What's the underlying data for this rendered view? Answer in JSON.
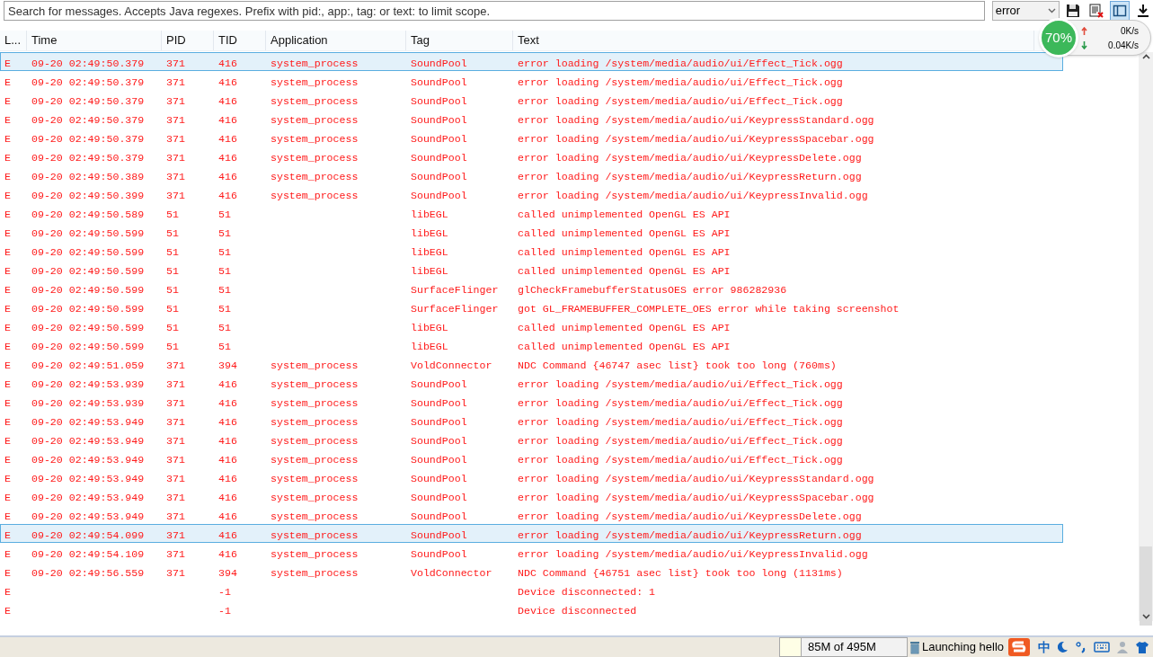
{
  "toolbar": {
    "search": {
      "placeholder": "Search for messages. Accepts Java regexes. Prefix with pid:, app:, tag: or text: to limit scope."
    },
    "level_filter": "error",
    "buttons": [
      {
        "kind": "save",
        "selected": false
      },
      {
        "kind": "clear",
        "selected": false
      },
      {
        "kind": "toggle",
        "selected": true
      },
      {
        "kind": "scroll",
        "selected": false
      }
    ]
  },
  "net_monitor": {
    "percent": "70%",
    "upload": "0K/s",
    "download": "0.04K/s"
  },
  "table": {
    "columns": [
      "L...",
      "Time",
      "PID",
      "TID",
      "Application",
      "Tag",
      "Text"
    ],
    "rows": [
      {
        "selected": true,
        "cells": [
          "E",
          "09-20 02:49:50.379",
          "371",
          "416",
          "system_process",
          "SoundPool",
          "error loading /system/media/audio/ui/Effect_Tick.ogg"
        ]
      },
      {
        "selected": false,
        "cells": [
          "E",
          "09-20 02:49:50.379",
          "371",
          "416",
          "system_process",
          "SoundPool",
          "error loading /system/media/audio/ui/Effect_Tick.ogg"
        ]
      },
      {
        "selected": false,
        "cells": [
          "E",
          "09-20 02:49:50.379",
          "371",
          "416",
          "system_process",
          "SoundPool",
          "error loading /system/media/audio/ui/Effect_Tick.ogg"
        ]
      },
      {
        "selected": false,
        "cells": [
          "E",
          "09-20 02:49:50.379",
          "371",
          "416",
          "system_process",
          "SoundPool",
          "error loading /system/media/audio/ui/KeypressStandard.ogg"
        ]
      },
      {
        "selected": false,
        "cells": [
          "E",
          "09-20 02:49:50.379",
          "371",
          "416",
          "system_process",
          "SoundPool",
          "error loading /system/media/audio/ui/KeypressSpacebar.ogg"
        ]
      },
      {
        "selected": false,
        "cells": [
          "E",
          "09-20 02:49:50.379",
          "371",
          "416",
          "system_process",
          "SoundPool",
          "error loading /system/media/audio/ui/KeypressDelete.ogg"
        ]
      },
      {
        "selected": false,
        "cells": [
          "E",
          "09-20 02:49:50.389",
          "371",
          "416",
          "system_process",
          "SoundPool",
          "error loading /system/media/audio/ui/KeypressReturn.ogg"
        ]
      },
      {
        "selected": false,
        "cells": [
          "E",
          "09-20 02:49:50.399",
          "371",
          "416",
          "system_process",
          "SoundPool",
          "error loading /system/media/audio/ui/KeypressInvalid.ogg"
        ]
      },
      {
        "selected": false,
        "cells": [
          "E",
          "09-20 02:49:50.589",
          "51",
          "51",
          "",
          "libEGL",
          "called unimplemented OpenGL ES API"
        ]
      },
      {
        "selected": false,
        "cells": [
          "E",
          "09-20 02:49:50.599",
          "51",
          "51",
          "",
          "libEGL",
          "called unimplemented OpenGL ES API"
        ]
      },
      {
        "selected": false,
        "cells": [
          "E",
          "09-20 02:49:50.599",
          "51",
          "51",
          "",
          "libEGL",
          "called unimplemented OpenGL ES API"
        ]
      },
      {
        "selected": false,
        "cells": [
          "E",
          "09-20 02:49:50.599",
          "51",
          "51",
          "",
          "libEGL",
          "called unimplemented OpenGL ES API"
        ]
      },
      {
        "selected": false,
        "cells": [
          "E",
          "09-20 02:49:50.599",
          "51",
          "51",
          "",
          "SurfaceFlinger",
          "glCheckFramebufferStatusOES error 986282936"
        ]
      },
      {
        "selected": false,
        "cells": [
          "E",
          "09-20 02:49:50.599",
          "51",
          "51",
          "",
          "SurfaceFlinger",
          "got GL_FRAMEBUFFER_COMPLETE_OES error while taking screenshot"
        ]
      },
      {
        "selected": false,
        "cells": [
          "E",
          "09-20 02:49:50.599",
          "51",
          "51",
          "",
          "libEGL",
          "called unimplemented OpenGL ES API"
        ]
      },
      {
        "selected": false,
        "cells": [
          "E",
          "09-20 02:49:50.599",
          "51",
          "51",
          "",
          "libEGL",
          "called unimplemented OpenGL ES API"
        ]
      },
      {
        "selected": false,
        "cells": [
          "E",
          "09-20 02:49:51.059",
          "371",
          "394",
          "system_process",
          "VoldConnector",
          "NDC Command {46747 asec list} took too long (760ms)"
        ]
      },
      {
        "selected": false,
        "cells": [
          "E",
          "09-20 02:49:53.939",
          "371",
          "416",
          "system_process",
          "SoundPool",
          "error loading /system/media/audio/ui/Effect_Tick.ogg"
        ]
      },
      {
        "selected": false,
        "cells": [
          "E",
          "09-20 02:49:53.939",
          "371",
          "416",
          "system_process",
          "SoundPool",
          "error loading /system/media/audio/ui/Effect_Tick.ogg"
        ]
      },
      {
        "selected": false,
        "cells": [
          "E",
          "09-20 02:49:53.949",
          "371",
          "416",
          "system_process",
          "SoundPool",
          "error loading /system/media/audio/ui/Effect_Tick.ogg"
        ]
      },
      {
        "selected": false,
        "cells": [
          "E",
          "09-20 02:49:53.949",
          "371",
          "416",
          "system_process",
          "SoundPool",
          "error loading /system/media/audio/ui/Effect_Tick.ogg"
        ]
      },
      {
        "selected": false,
        "cells": [
          "E",
          "09-20 02:49:53.949",
          "371",
          "416",
          "system_process",
          "SoundPool",
          "error loading /system/media/audio/ui/Effect_Tick.ogg"
        ]
      },
      {
        "selected": false,
        "cells": [
          "E",
          "09-20 02:49:53.949",
          "371",
          "416",
          "system_process",
          "SoundPool",
          "error loading /system/media/audio/ui/KeypressStandard.ogg"
        ]
      },
      {
        "selected": false,
        "cells": [
          "E",
          "09-20 02:49:53.949",
          "371",
          "416",
          "system_process",
          "SoundPool",
          "error loading /system/media/audio/ui/KeypressSpacebar.ogg"
        ]
      },
      {
        "selected": false,
        "cells": [
          "E",
          "09-20 02:49:53.949",
          "371",
          "416",
          "system_process",
          "SoundPool",
          "error loading /system/media/audio/ui/KeypressDelete.ogg"
        ]
      },
      {
        "selected": true,
        "cells": [
          "E",
          "09-20 02:49:54.099",
          "371",
          "416",
          "system_process",
          "SoundPool",
          "error loading /system/media/audio/ui/KeypressReturn.ogg"
        ]
      },
      {
        "selected": false,
        "cells": [
          "E",
          "09-20 02:49:54.109",
          "371",
          "416",
          "system_process",
          "SoundPool",
          "error loading /system/media/audio/ui/KeypressInvalid.ogg"
        ]
      },
      {
        "selected": false,
        "cells": [
          "E",
          "09-20 02:49:56.559",
          "371",
          "394",
          "system_process",
          "VoldConnector",
          "NDC Command {46751 asec list} took too long (1131ms)"
        ]
      },
      {
        "selected": false,
        "cells": [
          "E",
          "",
          "",
          "-1",
          "",
          "",
          "Device disconnected: 1"
        ]
      },
      {
        "selected": false,
        "cells": [
          "E",
          "",
          "",
          "-1",
          "",
          "",
          "Device disconnected"
        ]
      }
    ]
  },
  "status_bar": {
    "memory": "85M of 495M",
    "task": "Launching hello",
    "ime_mode": "中"
  }
}
